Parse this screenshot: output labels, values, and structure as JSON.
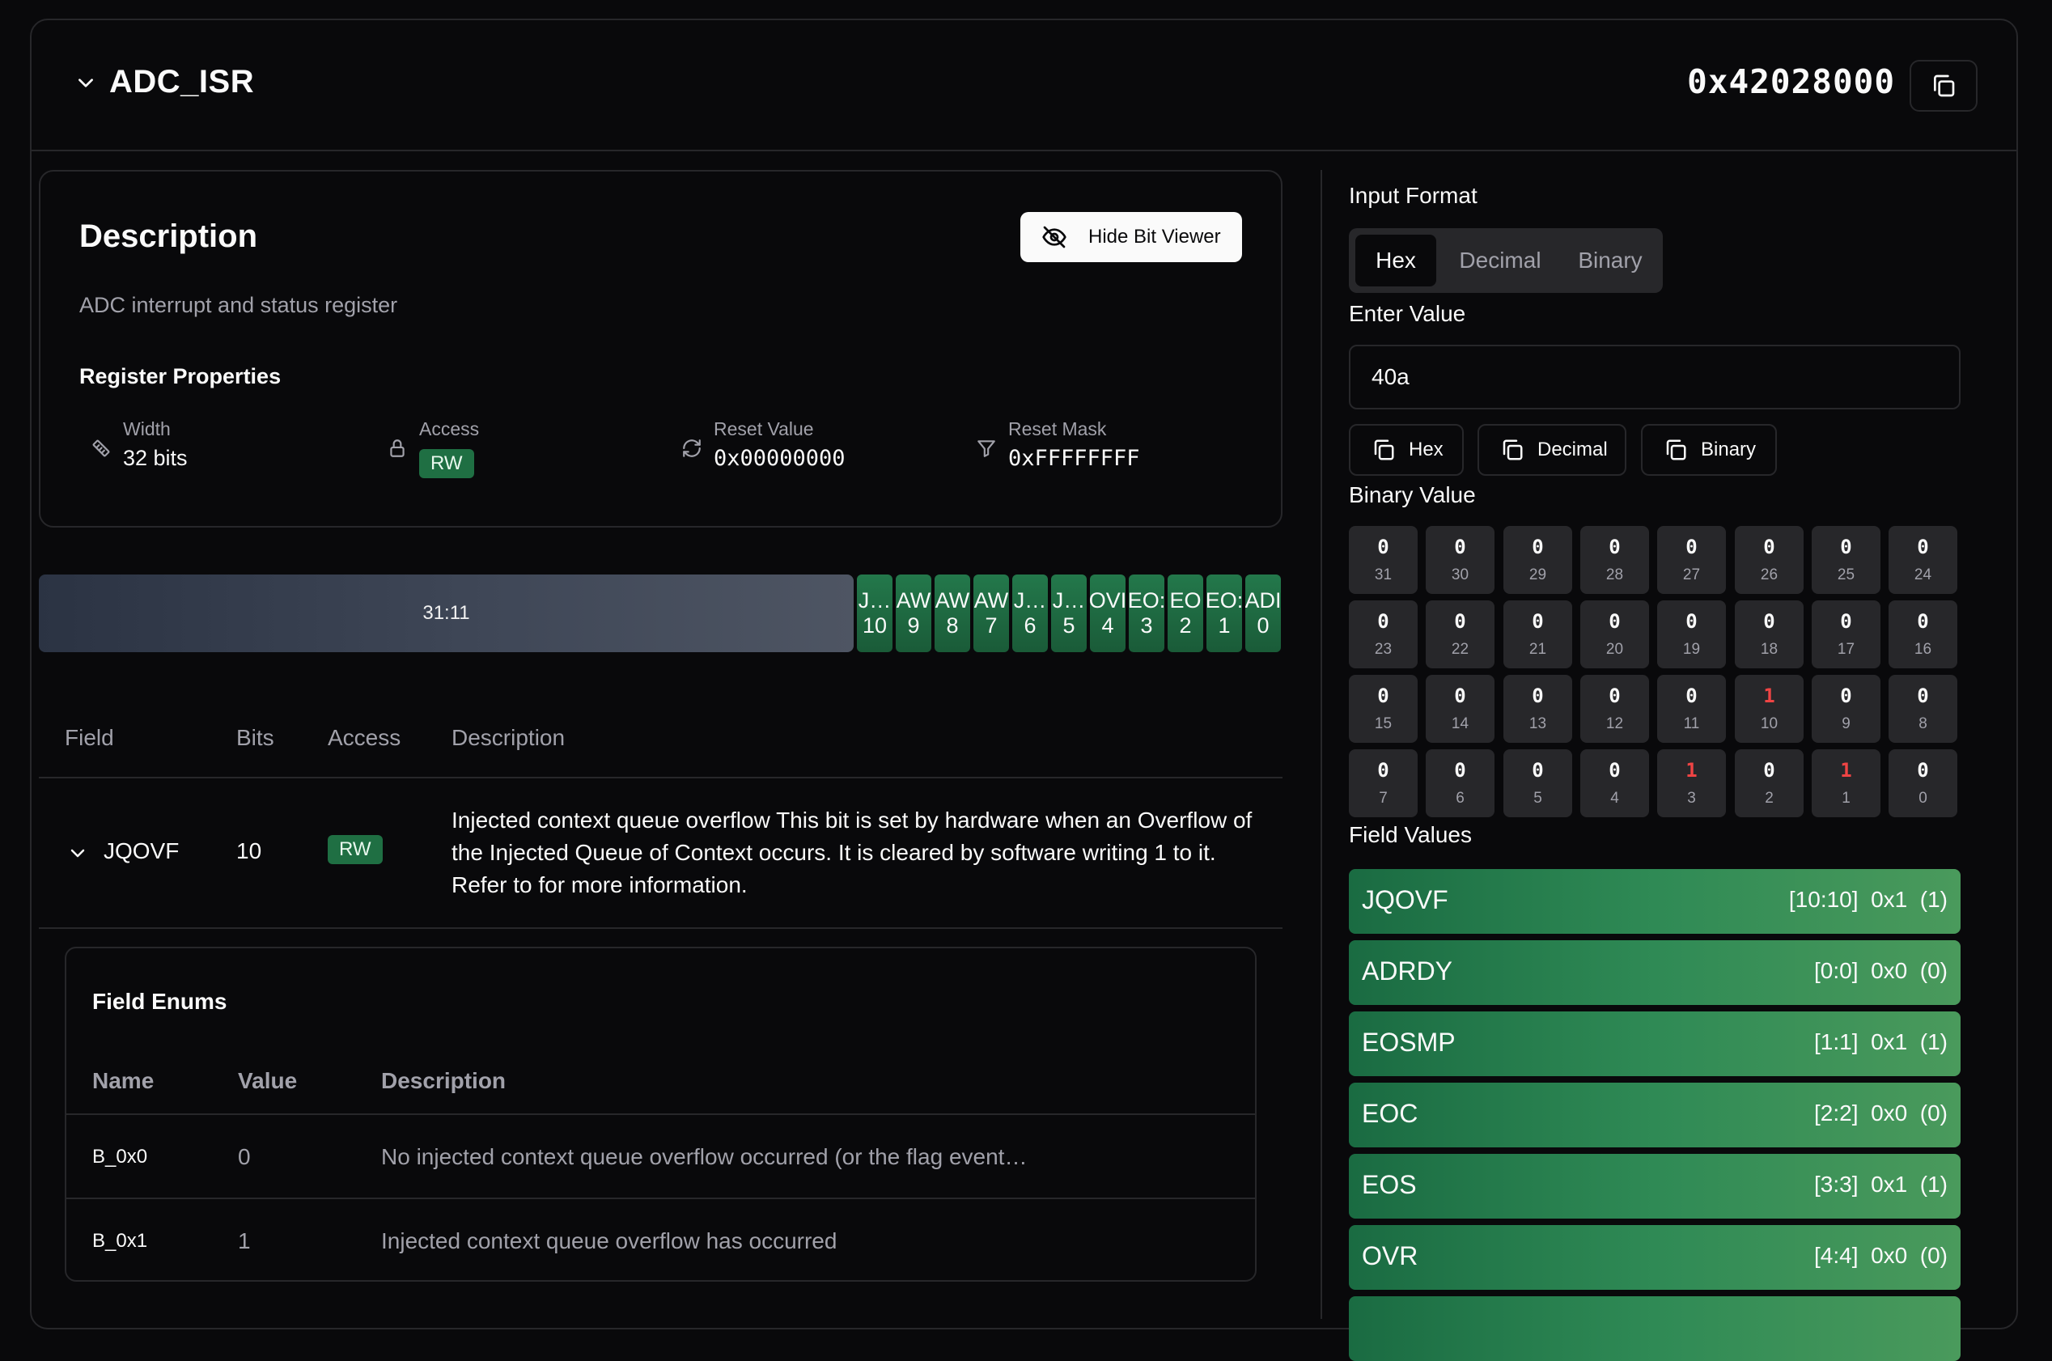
{
  "header": {
    "register_name": "ADC_ISR",
    "address": "0x42028000"
  },
  "description": {
    "title": "Description",
    "text": "ADC interrupt and status register",
    "hide_bit_viewer_label": "Hide Bit Viewer",
    "properties_title": "Register Properties",
    "properties": [
      {
        "label": "Width",
        "value": "32 bits",
        "icon": "ruler-icon"
      },
      {
        "label": "Access",
        "value": "RW",
        "icon": "lock-icon"
      },
      {
        "label": "Reset Value",
        "value": "0x00000000",
        "icon": "refresh-icon"
      },
      {
        "label": "Reset Mask",
        "value": "0xFFFFFFFF",
        "icon": "filter-icon"
      }
    ]
  },
  "bitbar": {
    "reserved": "31:11",
    "fields": [
      {
        "name": "J…",
        "bit": "10"
      },
      {
        "name": "AW",
        "bit": "9"
      },
      {
        "name": "AW",
        "bit": "8"
      },
      {
        "name": "AW",
        "bit": "7"
      },
      {
        "name": "J…",
        "bit": "6"
      },
      {
        "name": "J…",
        "bit": "5"
      },
      {
        "name": "OVI",
        "bit": "4"
      },
      {
        "name": "EO:",
        "bit": "3"
      },
      {
        "name": "EO",
        "bit": "2"
      },
      {
        "name": "EO:",
        "bit": "1"
      },
      {
        "name": "ADI",
        "bit": "0"
      }
    ]
  },
  "fields_table": {
    "headers": [
      "Field",
      "Bits",
      "Access",
      "Description"
    ],
    "row": {
      "name": "JQOVF",
      "bits": "10",
      "access": "RW",
      "description": "Injected context queue overflow This bit is set by hardware when an Overflow of the Injected Queue of Context occurs. It is cleared by software writing 1 to it. Refer to for more information."
    }
  },
  "field_enums": {
    "title": "Field Enums",
    "headers": [
      "Name",
      "Value",
      "Description"
    ],
    "rows": [
      {
        "name": "B_0x0",
        "value": "0",
        "description": "No injected context queue overflow occurred (or the flag event…"
      },
      {
        "name": "B_0x1",
        "value": "1",
        "description": "Injected context queue overflow has occurred"
      }
    ]
  },
  "bit_viewer": {
    "input_format_label": "Input Format",
    "formats": [
      "Hex",
      "Decimal",
      "Binary"
    ],
    "selected_format": "Hex",
    "enter_value_label": "Enter Value",
    "value": "40a",
    "copy_buttons": [
      "Hex",
      "Decimal",
      "Binary"
    ],
    "binary_value_label": "Binary Value",
    "bits": [
      {
        "n": "31",
        "v": "0"
      },
      {
        "n": "30",
        "v": "0"
      },
      {
        "n": "29",
        "v": "0"
      },
      {
        "n": "28",
        "v": "0"
      },
      {
        "n": "27",
        "v": "0"
      },
      {
        "n": "26",
        "v": "0"
      },
      {
        "n": "25",
        "v": "0"
      },
      {
        "n": "24",
        "v": "0"
      },
      {
        "n": "23",
        "v": "0"
      },
      {
        "n": "22",
        "v": "0"
      },
      {
        "n": "21",
        "v": "0"
      },
      {
        "n": "20",
        "v": "0"
      },
      {
        "n": "19",
        "v": "0"
      },
      {
        "n": "18",
        "v": "0"
      },
      {
        "n": "17",
        "v": "0"
      },
      {
        "n": "16",
        "v": "0"
      },
      {
        "n": "15",
        "v": "0"
      },
      {
        "n": "14",
        "v": "0"
      },
      {
        "n": "13",
        "v": "0"
      },
      {
        "n": "12",
        "v": "0"
      },
      {
        "n": "11",
        "v": "0"
      },
      {
        "n": "10",
        "v": "1"
      },
      {
        "n": "9",
        "v": "0"
      },
      {
        "n": "8",
        "v": "0"
      },
      {
        "n": "7",
        "v": "0"
      },
      {
        "n": "6",
        "v": "0"
      },
      {
        "n": "5",
        "v": "0"
      },
      {
        "n": "4",
        "v": "0"
      },
      {
        "n": "3",
        "v": "1"
      },
      {
        "n": "2",
        "v": "0"
      },
      {
        "n": "1",
        "v": "1"
      },
      {
        "n": "0",
        "v": "0"
      }
    ],
    "field_values_label": "Field Values",
    "field_values": [
      {
        "name": "JQOVF",
        "value": "[10:10]  0x1  (1)"
      },
      {
        "name": "ADRDY",
        "value": "[0:0]  0x0  (0)"
      },
      {
        "name": "EOSMP",
        "value": "[1:1]  0x1  (1)"
      },
      {
        "name": "EOC",
        "value": "[2:2]  0x0  (0)"
      },
      {
        "name": "EOS",
        "value": "[3:3]  0x1  (1)"
      },
      {
        "name": "OVR",
        "value": "[4:4]  0x0  (0)"
      }
    ]
  }
}
